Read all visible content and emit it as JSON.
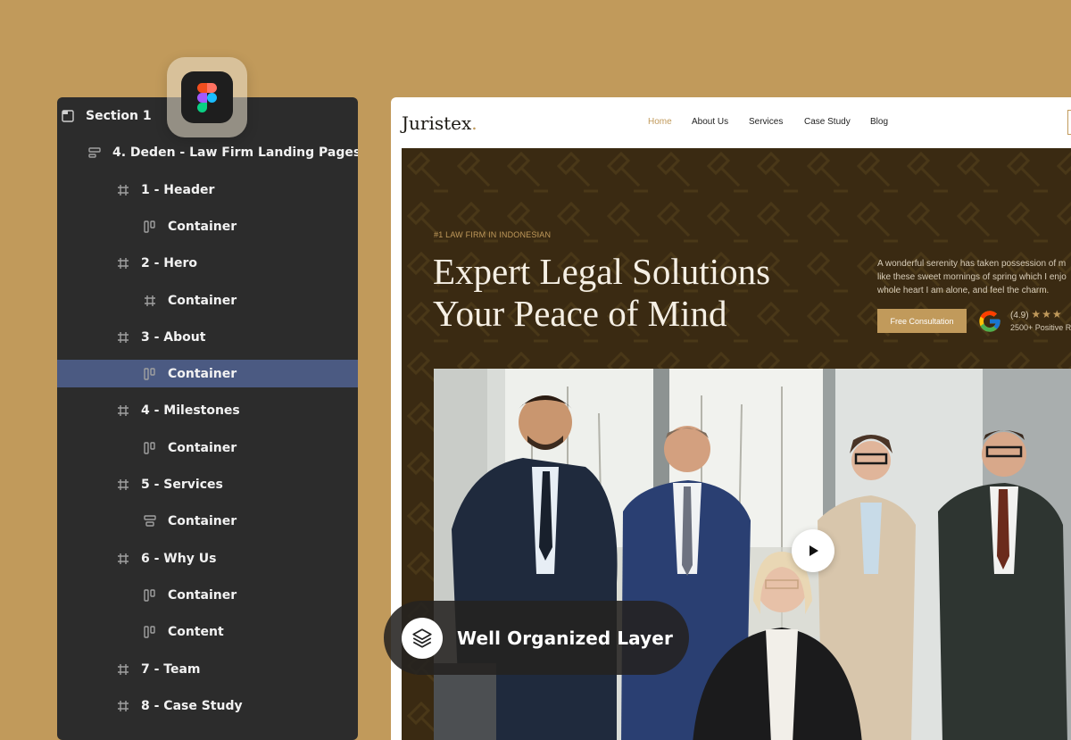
{
  "layers_panel": {
    "items": [
      {
        "label": "Section 1",
        "icon": "section-icon",
        "level": 0
      },
      {
        "label": "4. Deden - Law Firm Landing Pages",
        "icon": "auto-layout-icon",
        "level": 1
      },
      {
        "label": "1 - Header",
        "icon": "frame-icon",
        "level": 2
      },
      {
        "label": "Container",
        "icon": "auto-layout-horizontal-icon",
        "level": 3
      },
      {
        "label": "2 - Hero",
        "icon": "frame-icon",
        "level": 2
      },
      {
        "label": "Container",
        "icon": "frame-icon",
        "level": 3
      },
      {
        "label": "3 - About",
        "icon": "frame-icon",
        "level": 2
      },
      {
        "label": "Container",
        "icon": "auto-layout-horizontal-icon",
        "level": 3,
        "selected": true
      },
      {
        "label": "4 - Milestones",
        "icon": "frame-icon",
        "level": 2
      },
      {
        "label": "Container",
        "icon": "auto-layout-horizontal-icon",
        "level": 3
      },
      {
        "label": "5 - Services",
        "icon": "frame-icon",
        "level": 2
      },
      {
        "label": "Container",
        "icon": "auto-layout-vertical-icon",
        "level": 3
      },
      {
        "label": "6 - Why Us",
        "icon": "frame-icon",
        "level": 2
      },
      {
        "label": "Container",
        "icon": "auto-layout-horizontal-icon",
        "level": 3
      },
      {
        "label": "Content",
        "icon": "auto-layout-horizontal-icon",
        "level": 3
      },
      {
        "label": "7 - Team",
        "icon": "frame-icon",
        "level": 2
      },
      {
        "label": "8 - Case Study",
        "icon": "frame-icon",
        "level": 2
      }
    ]
  },
  "figma_badge": {
    "icon": "figma-logo-icon"
  },
  "site": {
    "brand": "Juristex",
    "brand_dot": ".",
    "nav": {
      "home": "Home",
      "about": "About Us",
      "services": "Services",
      "case_study": "Case Study",
      "blog": "Blog"
    },
    "hero": {
      "eyebrow": "#1 LAW FIRM IN INDONESIAN",
      "headline_line1": "Expert Legal Solutions",
      "headline_line2": "Your Peace of Mind",
      "description": "A wonderful serenity has taken possession of m\nlike these sweet mornings of spring which I enjo\nwhole heart I am alone, and feel the charm.",
      "cta": "Free Consultation",
      "rating": "(4.9)",
      "stars": "★★★",
      "reviews": "2500+ Positive R"
    },
    "photo": {
      "play_icon": "play-icon"
    }
  },
  "badge": {
    "label": "Well Organized Layer",
    "icon": "layers-icon"
  },
  "colors": {
    "background": "#c19a5b",
    "panel": "#2c2c2c",
    "selected_row": "#4b5a82",
    "hero_bg": "#3a2a12",
    "accent": "#c19a5b"
  }
}
